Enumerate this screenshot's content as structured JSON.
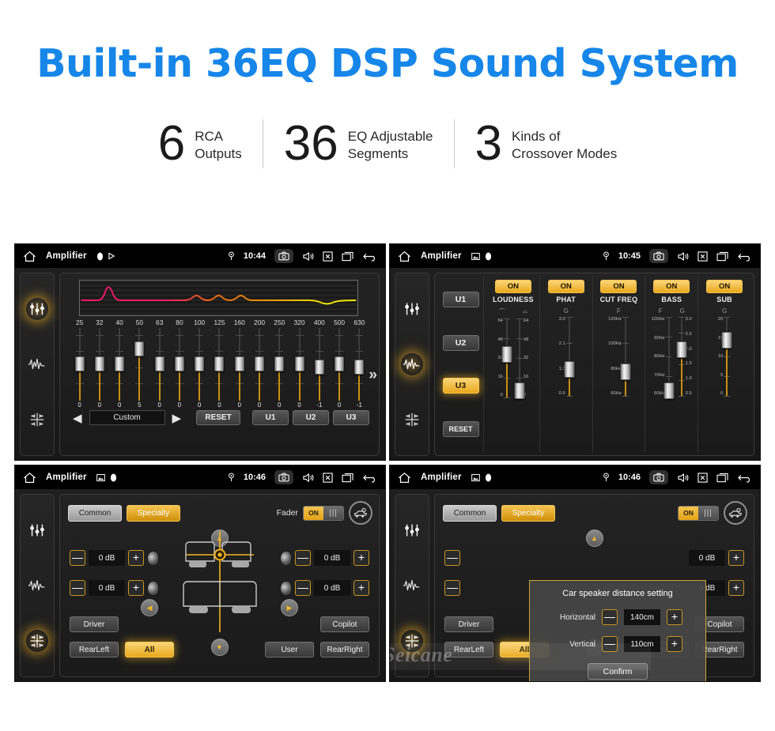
{
  "header": {
    "headline": "Built-in 36EQ DSP Sound System",
    "stats": [
      {
        "num": "6",
        "line1": "RCA",
        "line2": "Outputs"
      },
      {
        "num": "36",
        "line1": "EQ Adjustable",
        "line2": "Segments"
      },
      {
        "num": "3",
        "line1": "Kinds of",
        "line2": "Crossover Modes"
      }
    ]
  },
  "colors": {
    "headline_blue": "#1686e8",
    "accent_amber": "#e9a81c",
    "panel_bg": "#1d1d1d",
    "eq_fill": "#c98f14"
  },
  "screens": [
    {
      "id": "eq",
      "statusbar": {
        "title": "Amplifier",
        "time": "10:44",
        "icons": [
          "home-icon",
          "record-icon",
          "play-icon",
          "location-icon",
          "camera-icon",
          "volume-icon",
          "close-icon",
          "recents-icon",
          "back-icon"
        ]
      },
      "rail": [
        "equalizer-icon",
        "waveform-icon",
        "balance-icon"
      ],
      "rail_active": 0,
      "eq": {
        "frequencies": [
          "25",
          "32",
          "40",
          "50",
          "63",
          "80",
          "100",
          "125",
          "160",
          "200",
          "250",
          "320",
          "400",
          "500",
          "630"
        ],
        "values": [
          "0",
          "0",
          "0",
          "5",
          "0",
          "0",
          "0",
          "0",
          "0",
          "0",
          "0",
          "0",
          "-1",
          "0",
          "-1"
        ],
        "prev_label": "◀",
        "next_label": "▶",
        "preset": "Custom",
        "reset_label": "RESET",
        "user_presets": [
          "U1",
          "U2",
          "U3"
        ],
        "more_label": "»"
      }
    },
    {
      "id": "crossover",
      "statusbar": {
        "title": "Amplifier",
        "time": "10:45"
      },
      "rail_active": 1,
      "presets": [
        "U1",
        "U2",
        "U3"
      ],
      "preset_active": "U3",
      "reset_label": "RESET",
      "columns": [
        {
          "name": "LOUDNESS",
          "state": "ON",
          "sub": [
            "⌒",
            "⌓"
          ],
          "sliders": [
            {
              "scale": [
                "64",
                "48",
                "32",
                "16",
                "0"
              ],
              "value_pct": 54,
              "side": "left"
            },
            {
              "scale": [
                "64",
                "48",
                "32",
                "16",
                "0"
              ],
              "value_pct": 8,
              "side": "right"
            }
          ]
        },
        {
          "name": "PHAT",
          "state": "ON",
          "sub": [
            "G"
          ],
          "sliders": [
            {
              "scale": [
                "3.0",
                "2.1",
                "1.3",
                "0.5"
              ],
              "value_pct": 33,
              "side": "left"
            }
          ]
        },
        {
          "name": "CUT FREQ",
          "state": "ON",
          "sub": [
            "F"
          ],
          "sliders": [
            {
              "scale": [
                "120Hz",
                "100Hz",
                "80Hz",
                "60Hz"
              ],
              "value_pct": 30,
              "side": "left"
            }
          ]
        },
        {
          "name": "BASS",
          "state": "ON",
          "sub": [
            "F",
            "G"
          ],
          "sliders": [
            {
              "scale": [
                "100Hz",
                "90Hz",
                "80Hz",
                "70Hz",
                "60Hz"
              ],
              "value_pct": 6,
              "side": "left"
            },
            {
              "scale": [
                "3.0",
                "2.5",
                "2.0",
                "1.5",
                "1.0",
                "0.5"
              ],
              "value_pct": 58,
              "side": "right"
            }
          ]
        },
        {
          "name": "SUB",
          "state": "ON",
          "sub": [
            "G"
          ],
          "sliders": [
            {
              "scale": [
                "20",
                "15",
                "10",
                "5",
                "0"
              ],
              "value_pct": 70,
              "side": "left"
            }
          ]
        }
      ]
    },
    {
      "id": "fader",
      "statusbar": {
        "title": "Amplifier",
        "time": "10:46"
      },
      "rail_active": 2,
      "tabs": [
        {
          "label": "Common",
          "active": false
        },
        {
          "label": "Specialty",
          "active": true
        }
      ],
      "fader_label": "Fader",
      "fader_state": "ON",
      "car_button": "car-seat-icon",
      "db_fields": [
        {
          "position": "front-left",
          "value": "0 dB"
        },
        {
          "position": "front-right",
          "value": "0 dB"
        },
        {
          "position": "rear-left",
          "value": "0 dB"
        },
        {
          "position": "rear-right",
          "value": "0 dB"
        }
      ],
      "minus_label": "—",
      "plus_label": "+",
      "position_buttons": [
        {
          "label": "Driver",
          "active": false
        },
        {
          "label": "Copilot",
          "active": false
        },
        {
          "label": "RearLeft",
          "active": false
        },
        {
          "label": "All",
          "active": true
        },
        {
          "label": "User",
          "active": false
        },
        {
          "label": "RearRight",
          "active": false
        }
      ]
    },
    {
      "id": "distance-dialog",
      "statusbar": {
        "title": "Amplifier",
        "time": "10:46"
      },
      "rail_active": 2,
      "dialog": {
        "title": "Car speaker distance setting",
        "rows": [
          {
            "label": "Horizontal",
            "value": "140cm"
          },
          {
            "label": "Vertical",
            "value": "110cm"
          }
        ],
        "minus_label": "—",
        "plus_label": "+",
        "confirm_label": "Confirm"
      },
      "watermark": "Seicane"
    }
  ]
}
